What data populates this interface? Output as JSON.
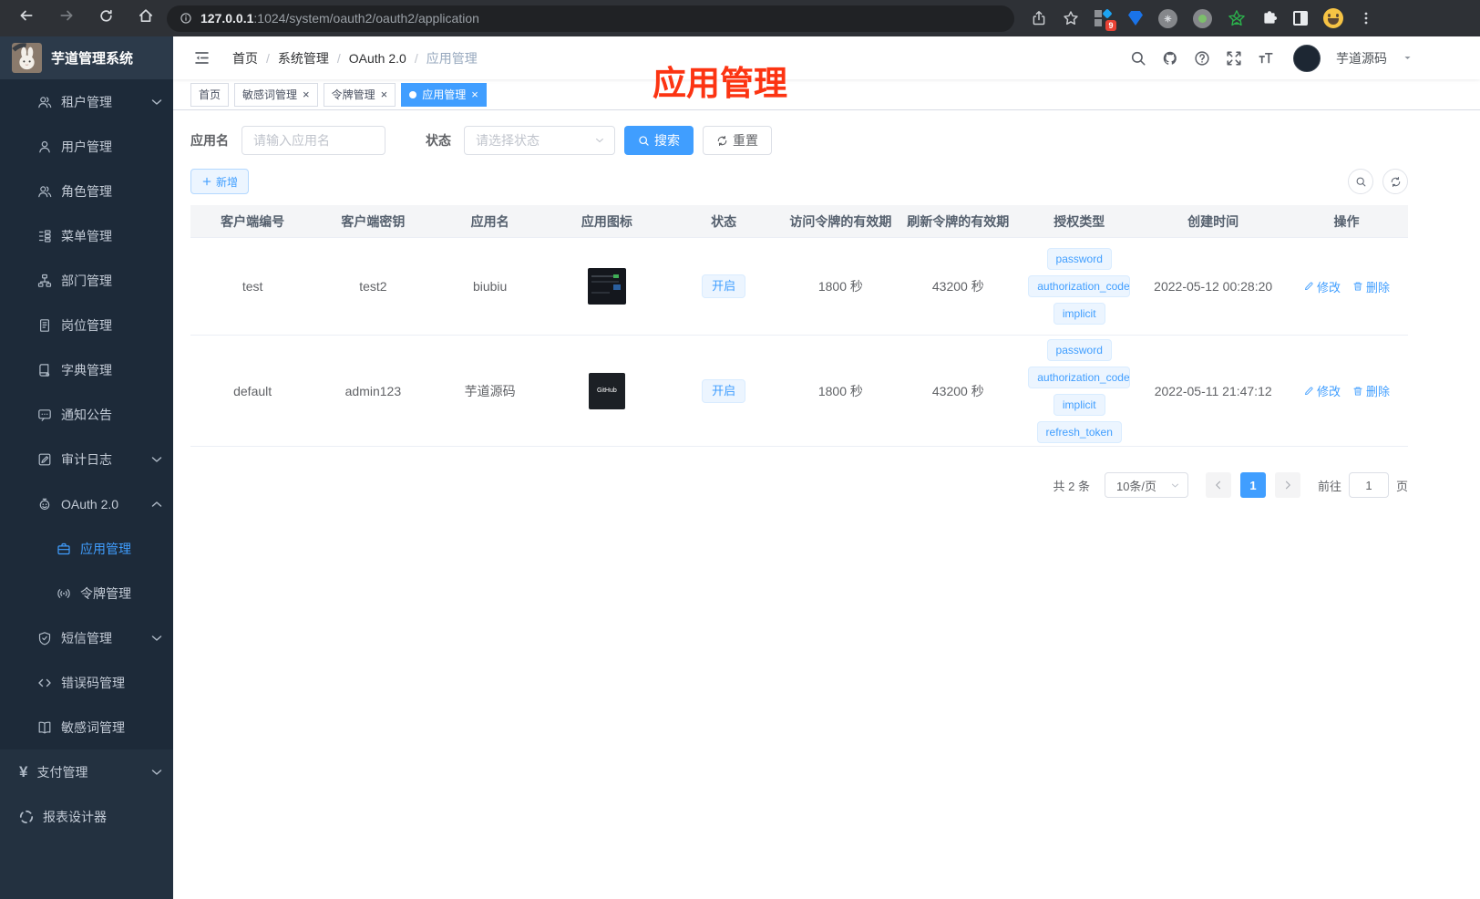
{
  "browser": {
    "url_host": "127.0.0.1",
    "url_rest": ":1024/system/oauth2/oauth2/application",
    "ext_badge": "9"
  },
  "sidebar": {
    "title": "芋道管理系统",
    "menu": [
      {
        "name": "tenant-management",
        "icon": "users-icon",
        "label": "租户管理",
        "level": 2,
        "chevron": "down"
      },
      {
        "name": "user-management",
        "icon": "user-icon",
        "label": "用户管理",
        "level": 2
      },
      {
        "name": "role-management",
        "icon": "role-users-icon",
        "label": "角色管理",
        "level": 2
      },
      {
        "name": "menu-management",
        "icon": "menu-tree-icon",
        "label": "菜单管理",
        "level": 2
      },
      {
        "name": "dept-management",
        "icon": "org-tree-icon",
        "label": "部门管理",
        "level": 2
      },
      {
        "name": "post-management",
        "icon": "post-badge-icon",
        "label": "岗位管理",
        "level": 2
      },
      {
        "name": "dict-management",
        "icon": "dict-book-icon",
        "label": "字典管理",
        "level": 2
      },
      {
        "name": "notice-management",
        "icon": "message-icon",
        "label": "通知公告",
        "level": 2
      },
      {
        "name": "audit-log",
        "icon": "edit-note-icon",
        "label": "审计日志",
        "level": 2,
        "chevron": "down"
      },
      {
        "name": "oauth2",
        "icon": "robot-icon",
        "label": "OAuth 2.0",
        "level": 2,
        "chevron": "up"
      },
      {
        "name": "oauth2-application",
        "icon": "briefcase-icon",
        "label": "应用管理",
        "level": 3,
        "active": true
      },
      {
        "name": "oauth2-token",
        "icon": "broadcast-icon",
        "label": "令牌管理",
        "level": 3
      },
      {
        "name": "sms-management",
        "icon": "shield-icon",
        "label": "短信管理",
        "level": 2,
        "chevron": "down"
      },
      {
        "name": "error-code-management",
        "icon": "code-icon",
        "label": "错误码管理",
        "level": 2
      },
      {
        "name": "sensitive-word-management",
        "icon": "open-book-icon",
        "label": "敏感词管理",
        "level": 2
      },
      {
        "name": "pay-management",
        "icon": "yen-icon",
        "label": "支付管理",
        "level": 1,
        "chevron": "down"
      },
      {
        "name": "report-designer",
        "icon": "compass-icon",
        "label": "报表设计器",
        "level": 1
      }
    ]
  },
  "header": {
    "breadcrumbs": [
      "首页",
      "系统管理",
      "OAuth 2.0",
      "应用管理"
    ],
    "username": "芋道源码"
  },
  "annotation": "应用管理",
  "tabs": [
    {
      "name": "home",
      "label": "首页",
      "closable": false,
      "active": false
    },
    {
      "name": "sensitive-word",
      "label": "敏感词管理",
      "closable": true,
      "active": false
    },
    {
      "name": "token",
      "label": "令牌管理",
      "closable": true,
      "active": false
    },
    {
      "name": "application",
      "label": "应用管理",
      "closable": true,
      "active": true
    }
  ],
  "filters": {
    "name_label": "应用名",
    "name_placeholder": "请输入应用名",
    "status_label": "状态",
    "status_placeholder": "请选择状态",
    "search_label": "搜索",
    "reset_label": "重置",
    "add_label": "新增"
  },
  "table": {
    "headers": [
      "客户端编号",
      "客户端密钥",
      "应用名",
      "应用图标",
      "状态",
      "访问令牌的有效期",
      "刷新令牌的有效期",
      "授权类型",
      "创建时间",
      "操作"
    ],
    "rows": [
      {
        "client_id": "test",
        "secret": "test2",
        "name": "biubiu",
        "icon": "screenshot-thumbnail",
        "icon_label": "",
        "status": "开启",
        "access": "1800 秒",
        "refresh": "43200 秒",
        "grants": [
          "password",
          "authorization_code",
          "implicit"
        ],
        "created": "2022-05-12 00:28:20"
      },
      {
        "client_id": "default",
        "secret": "admin123",
        "name": "芋道源码",
        "icon": "github-dark",
        "icon_label": "GitHub",
        "status": "开启",
        "access": "1800 秒",
        "refresh": "43200 秒",
        "grants": [
          "password",
          "authorization_code",
          "implicit",
          "refresh_token"
        ],
        "created": "2022-05-11 21:47:12"
      }
    ],
    "actions": {
      "edit": "修改",
      "delete": "删除"
    }
  },
  "pagination": {
    "total": "共 2 条",
    "page_size": "10条/页",
    "current_page": "1",
    "goto_prefix": "前往",
    "goto_value": "1",
    "goto_suffix": "页"
  },
  "colors": {
    "accent": "#409eff",
    "annotation_red": "#fc3412",
    "tag_bg": "#ecf5ff",
    "sidebar_bg": "#233140",
    "submenu_bg": "#1d2a39"
  }
}
